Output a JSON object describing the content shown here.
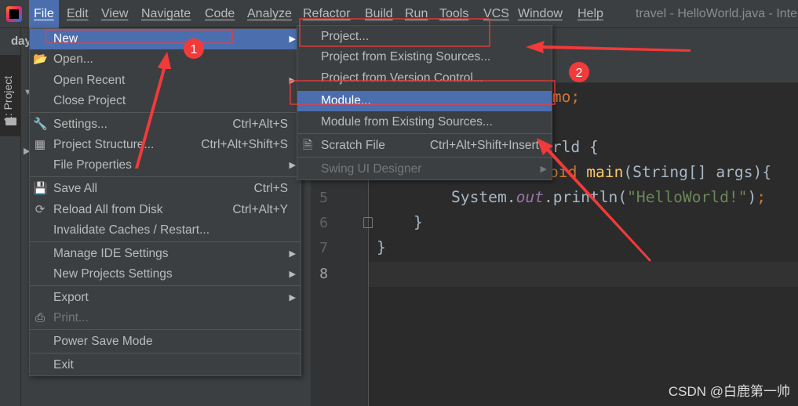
{
  "menubar": {
    "items": [
      "File",
      "Edit",
      "View",
      "Navigate",
      "Code",
      "Analyze",
      "Refactor",
      "Build",
      "Run",
      "Tools",
      "VCS",
      "Window",
      "Help"
    ],
    "active": "File"
  },
  "window_title": "travel - HelloWorld.java - Inte",
  "project_panel": {
    "title": "day",
    "tool_tab": "1: Project"
  },
  "file_menu": {
    "items": [
      {
        "label": "New",
        "arrow": true,
        "highlighted": true
      },
      {
        "label": "Open...",
        "icon": "folder-open-icon"
      },
      {
        "label": "Open Recent",
        "arrow": true
      },
      {
        "label": "Close Project"
      },
      {
        "label": "Settings...",
        "shortcut": "Ctrl+Alt+S",
        "icon": "wrench-icon"
      },
      {
        "label": "Project Structure...",
        "shortcut": "Ctrl+Alt+Shift+S",
        "icon": "project-structure-icon"
      },
      {
        "label": "File Properties",
        "arrow": true
      },
      {
        "label": "Save All",
        "shortcut": "Ctrl+S",
        "icon": "save-icon"
      },
      {
        "label": "Reload All from Disk",
        "shortcut": "Ctrl+Alt+Y",
        "icon": "reload-icon"
      },
      {
        "label": "Invalidate Caches / Restart..."
      },
      {
        "label": "Manage IDE Settings",
        "arrow": true
      },
      {
        "label": "New Projects Settings",
        "arrow": true
      },
      {
        "label": "Export",
        "arrow": true
      },
      {
        "label": "Print...",
        "icon": "print-icon",
        "disabled": true
      },
      {
        "label": "Power Save Mode"
      },
      {
        "label": "Exit"
      }
    ]
  },
  "new_submenu": {
    "items": [
      {
        "label": "Project..."
      },
      {
        "label": "Project from Existing Sources..."
      },
      {
        "label": "Project from Version Control..."
      },
      {
        "label": "Module...",
        "highlighted": true
      },
      {
        "label": "Module from Existing Sources..."
      },
      {
        "label": "Scratch File",
        "shortcut": "Ctrl+Alt+Shift+Insert",
        "icon": "scratch-file-icon"
      },
      {
        "label": "Swing UI Designer",
        "arrow": true,
        "disabled": true
      }
    ]
  },
  "editor": {
    "line_numbers": [
      "5",
      "6",
      "7",
      "8"
    ],
    "line1_visible": "emo;",
    "line3_visible": "orld {",
    "line4": {
      "kw": "oid",
      "fn": "main",
      "rest": "(String[] args){"
    },
    "line5": {
      "a": "System.",
      "b": "out",
      "c": ".println(",
      "d": "\"HelloWorld!\"",
      "e": ")",
      "f": ";"
    },
    "line6": "}",
    "line7": "}"
  },
  "annotations": {
    "badge1": "1",
    "badge2": "2",
    "color": "#f23a3a"
  },
  "watermark": "CSDN @白鹿第一帅",
  "colors": {
    "accent": "#4b6eaf",
    "bg": "#3c3f41",
    "editor": "#2b2b2b"
  }
}
